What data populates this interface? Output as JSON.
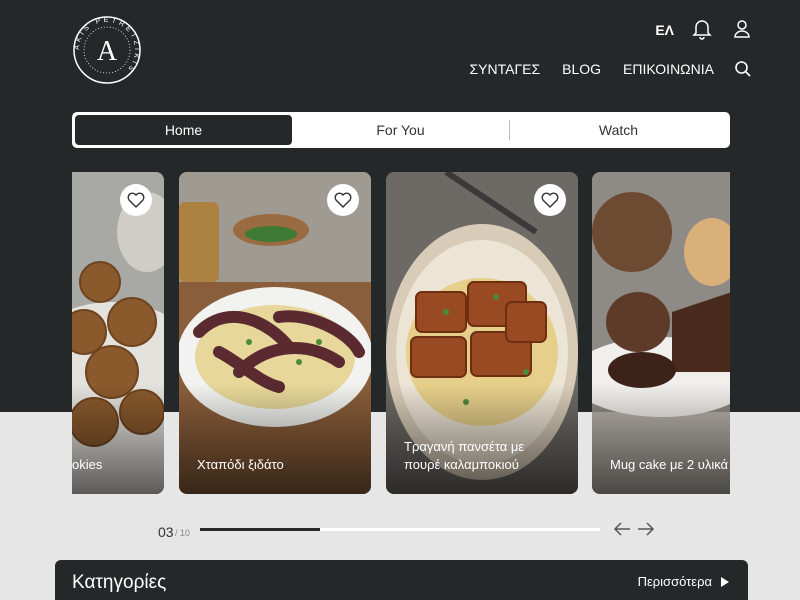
{
  "header": {
    "logo_text": "A",
    "logo_ring": "AKIS PETRETZIKIS",
    "lang": "ΕΛ",
    "nav": [
      "ΣΥΝΤΑΓΕΣ",
      "BLOG",
      "ΕΠΙΚΟΙΝΩΝΙΑ"
    ]
  },
  "tabs": [
    "Home",
    "For You",
    "Watch"
  ],
  "active_tab": "Home",
  "cards": [
    {
      "title": "okies"
    },
    {
      "title": "Χταπόδι ξιδάτο"
    },
    {
      "title": "Τραγανή πανσέτα με πουρέ καλαμποκιού"
    },
    {
      "title": "Mug cake με 2 υλικά"
    }
  ],
  "pager": {
    "current": "03",
    "total": "/ 10",
    "progress": 0.3
  },
  "categories": {
    "title": "Κατηγορίες",
    "more_label": "Περισσότερα"
  },
  "colors": {
    "dark": "#252828",
    "light_bg": "#e6e6e6"
  }
}
